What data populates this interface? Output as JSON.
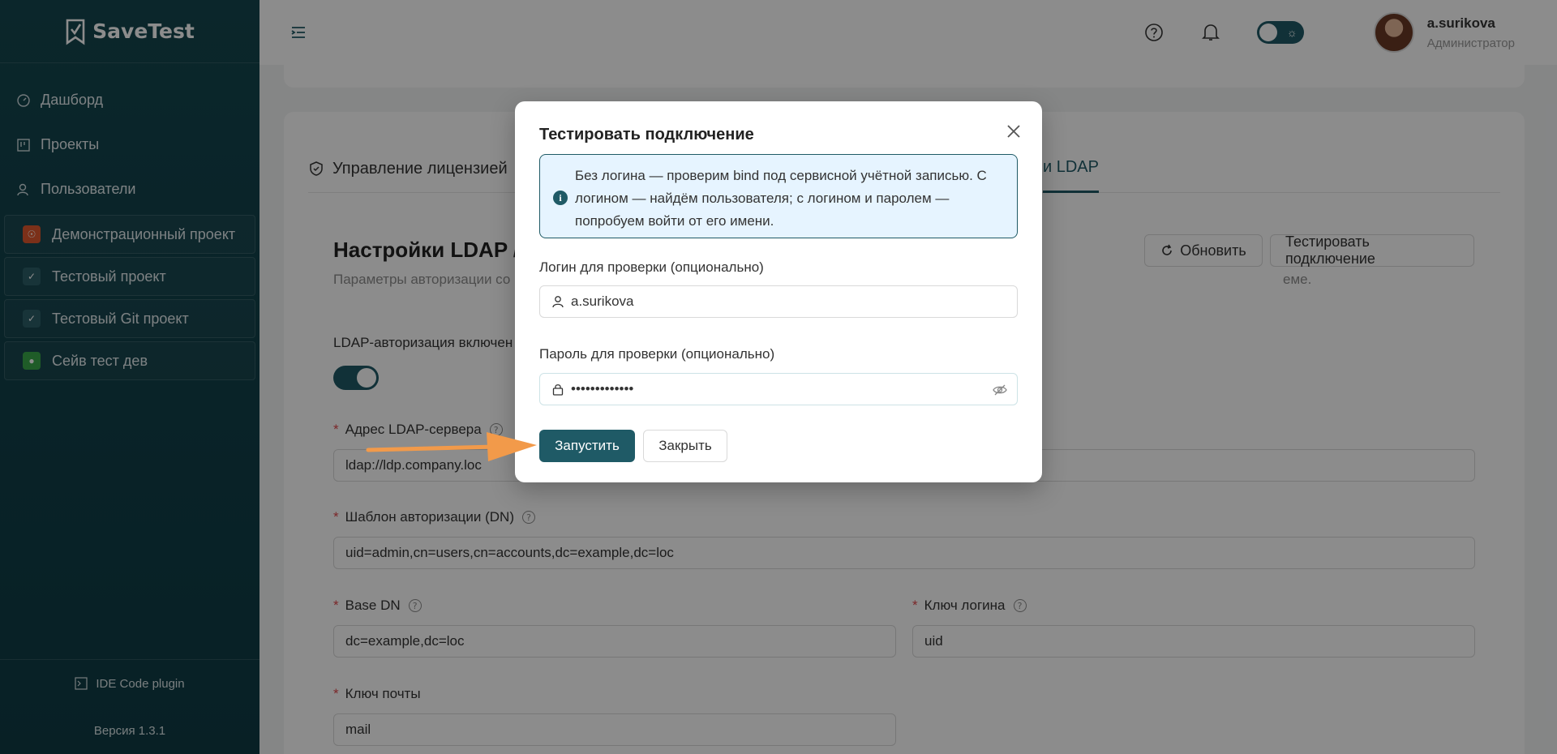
{
  "app": {
    "name": "SaveTest"
  },
  "sidebar": {
    "nav": [
      {
        "label": "Дашборд",
        "icon": "dashboard-icon"
      },
      {
        "label": "Проекты",
        "icon": "projects-icon"
      },
      {
        "label": "Пользователи",
        "icon": "users-icon"
      }
    ],
    "projects": [
      {
        "label": "Демонстрационный проект",
        "color": "#e0582e"
      },
      {
        "label": "Тестовый проект",
        "color": "#2c5f69"
      },
      {
        "label": "Тестовый Git проект",
        "color": "#2c5f69"
      },
      {
        "label": "Сейв тест дев",
        "color": "#3aa84a"
      }
    ],
    "plugin_label": "IDE Code plugin",
    "version": "Версия 1.3.1"
  },
  "header": {
    "user_name": "a.surikova",
    "user_role": "Администратор"
  },
  "page": {
    "tab_license": "Управление лицензией",
    "tab_ldap_partial": "и LDAP",
    "title": "Настройки LDAP / A",
    "subtitle_left": "Параметры авторизации со",
    "subtitle_right": "еме.",
    "refresh_button": "Обновить",
    "test_button": "Тестировать подключение",
    "ldap_enabled_label": "LDAP-авторизация включен",
    "ldap_enabled": true,
    "server_label": "Адрес LDAP-сервера",
    "server_value": "ldap://ldp.company.loc",
    "dn_label": "Шаблон авторизации (DN)",
    "dn_value": "uid=admin,cn=users,cn=accounts,dc=example,dc=loc",
    "base_dn_label": "Base DN",
    "base_dn_value": "dc=example,dc=loc",
    "login_key_label": "Ключ логина",
    "login_key_value": "uid",
    "mail_key_label": "Ключ почты",
    "mail_key_value": "mail"
  },
  "modal": {
    "title": "Тестировать подключение",
    "info": "Без логина — проверим bind под сервисной учётной записью. С логином — найдём пользователя; с логином и паролем — попробуем войти от его имени.",
    "login_label": "Логин для проверки (опционально)",
    "login_value": "a.surikova",
    "password_label": "Пароль для проверки (опционально)",
    "password_value": "•••••••••••••",
    "run_button": "Запустить",
    "close_button": "Закрыть"
  },
  "colors": {
    "accent": "#1f5a66",
    "sidebar": "#14464f",
    "annotation_arrow": "#f29a4a"
  }
}
